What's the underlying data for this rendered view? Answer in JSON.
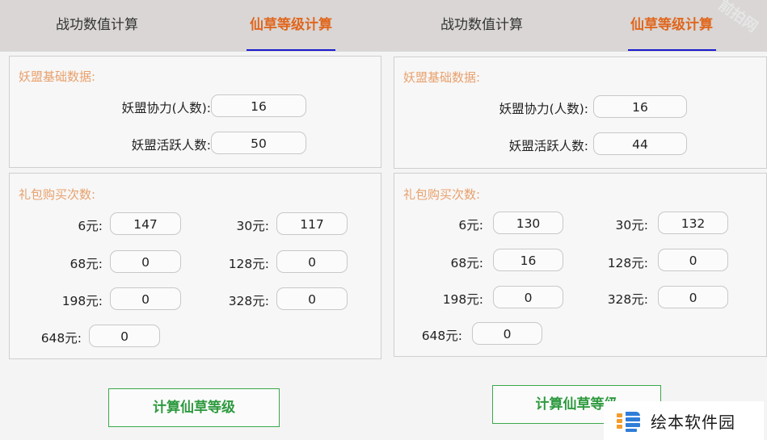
{
  "left": {
    "tabs": [
      "战功数值计算",
      "仙草等级计算"
    ],
    "base_title": "妖盟基础数据:",
    "base_rows": [
      {
        "label": "妖盟协力(人数):",
        "value": "16"
      },
      {
        "label": "妖盟活跃人数:",
        "value": "50"
      }
    ],
    "gift_title": "礼包购买次数:",
    "gifts": [
      {
        "label": "6元:",
        "value": "147"
      },
      {
        "label": "30元:",
        "value": "117"
      },
      {
        "label": "68元:",
        "value": "0"
      },
      {
        "label": "128元:",
        "value": "0"
      },
      {
        "label": "198元:",
        "value": "0"
      },
      {
        "label": "328元:",
        "value": "0"
      },
      {
        "label": "648元:",
        "value": "0"
      }
    ],
    "button": "计算仙草等级"
  },
  "right": {
    "tabs": [
      "战功数值计算",
      "仙草等级计算"
    ],
    "base_title": "妖盟基础数据:",
    "base_rows": [
      {
        "label": "妖盟协力(人数):",
        "value": "16"
      },
      {
        "label": "妖盟活跃人数:",
        "value": "44"
      }
    ],
    "gift_title": "礼包购买次数:",
    "gifts": [
      {
        "label": "6元:",
        "value": "130"
      },
      {
        "label": "30元:",
        "value": "132"
      },
      {
        "label": "68元:",
        "value": "16"
      },
      {
        "label": "128元:",
        "value": "0"
      },
      {
        "label": "198元:",
        "value": "0"
      },
      {
        "label": "328元:",
        "value": "0"
      },
      {
        "label": "648元:",
        "value": "0"
      }
    ],
    "button": "计算仙草等级"
  },
  "watermark": {
    "text": "绘本软件园"
  },
  "corner_watermark": {
    "text": "前拍网"
  }
}
